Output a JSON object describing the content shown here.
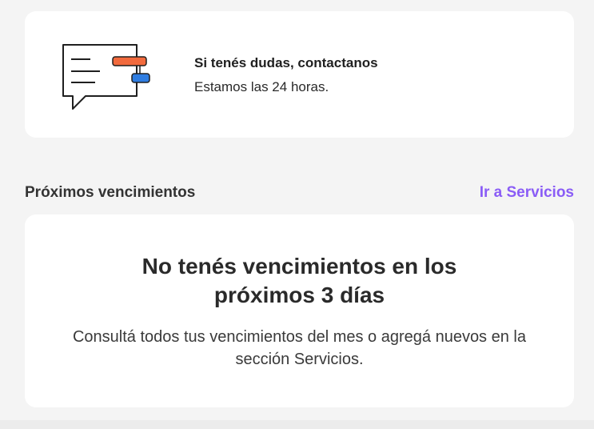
{
  "contact": {
    "icon": "chat-bubble-icon",
    "title": "Si tenés dudas, contactanos",
    "subtitle": "Estamos las 24 horas."
  },
  "upcoming": {
    "title": "Próximos vencimientos",
    "link_label": "Ir a Servicios",
    "empty_title": "No tenés vencimientos en los próximos 3 días",
    "empty_body": "Consultá todos tus vencimientos del mes o agregá nuevos en la sección Servicios."
  },
  "colors": {
    "accent_purple": "#8a5cf6",
    "icon_orange": "#f26a3d",
    "icon_blue": "#2f7de1",
    "background": "#f4f4f4"
  }
}
